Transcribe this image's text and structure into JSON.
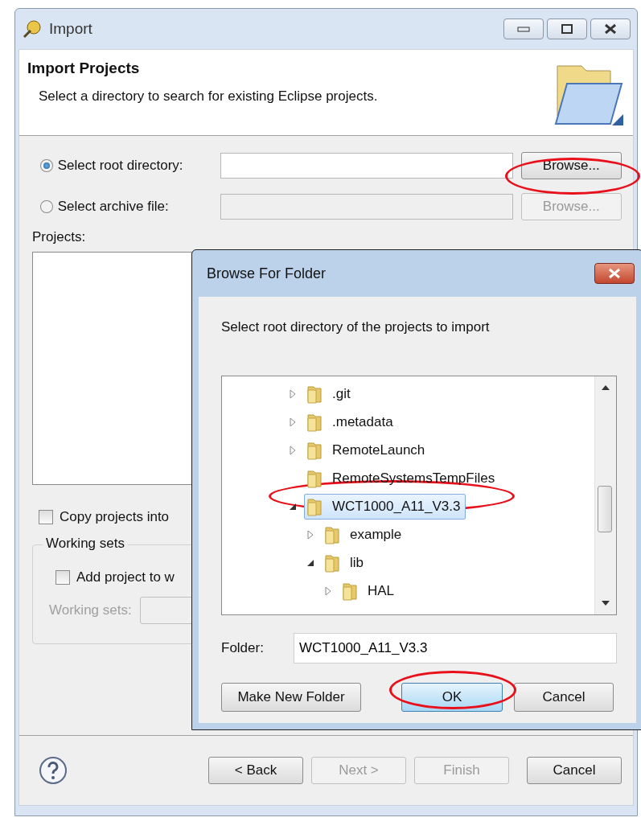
{
  "window": {
    "title": "Import"
  },
  "header": {
    "title": "Import Projects",
    "description": "Select a directory to search for existing Eclipse projects."
  },
  "source_options": [
    {
      "label": "Select root directory:",
      "selected": true,
      "disabled": false,
      "browse_label": "Browse...",
      "browse_disabled": false
    },
    {
      "label": "Select archive file:",
      "selected": false,
      "disabled": true,
      "browse_label": "Browse...",
      "browse_disabled": true
    }
  ],
  "projects_label": "Projects:",
  "copy_checkbox": {
    "label": "Copy projects into",
    "checked": false
  },
  "working_sets": {
    "title": "Working sets",
    "add_checkbox": {
      "label": "Add project to w",
      "checked": false
    },
    "field_label": "Working sets:",
    "disabled": true
  },
  "footer_buttons": [
    {
      "label": "< Back",
      "disabled": false
    },
    {
      "label": "Next >",
      "disabled": true
    },
    {
      "label": "Finish",
      "disabled": true
    },
    {
      "label": "Cancel",
      "disabled": false
    }
  ],
  "browse_dialog": {
    "title": "Browse For Folder",
    "instruction": "Select root directory of the projects to import",
    "tree": [
      {
        "name": ".git",
        "kind": "branch",
        "expanded": false,
        "selected": false
      },
      {
        "name": ".metadata",
        "kind": "branch",
        "expanded": false,
        "selected": false
      },
      {
        "name": "RemoteLaunch",
        "kind": "branch",
        "expanded": false,
        "selected": false
      },
      {
        "name": "RemoteSystemsTempFiles",
        "kind": "leaf",
        "selected": false
      },
      {
        "name": "WCT1000_A11_V3.3",
        "kind": "branch",
        "expanded": true,
        "selected": true,
        "children": [
          {
            "name": "example",
            "kind": "branch",
            "expanded": false,
            "selected": false
          },
          {
            "name": "lib",
            "kind": "branch",
            "expanded": true,
            "selected": false,
            "children": [
              {
                "name": "HAL",
                "kind": "branch",
                "expanded": false,
                "selected": false
              }
            ]
          }
        ]
      }
    ],
    "folder_label": "Folder:",
    "folder_value": "WCT1000_A11_V3.3",
    "buttons": [
      {
        "label": "Make New Folder",
        "default": false
      },
      {
        "label": "OK",
        "default": true
      },
      {
        "label": "Cancel",
        "default": false
      }
    ]
  }
}
